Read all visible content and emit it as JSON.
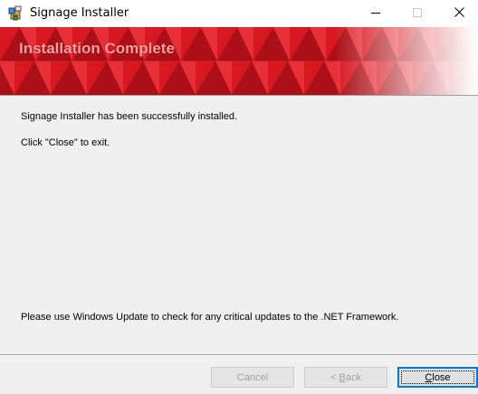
{
  "window": {
    "title": "Signage Installer",
    "icon": "installer-package-icon",
    "controls": {
      "minimize_icon": "minimize-icon",
      "maximize_icon": "maximize-icon",
      "close_icon": "close-icon"
    }
  },
  "banner": {
    "title": "Installation Complete",
    "colors": {
      "primary": "#d81820",
      "dark": "#8a0a12",
      "light": "#f04048"
    }
  },
  "content": {
    "success_message": "Signage Installer has been successfully installed.",
    "exit_instruction": "Click \"Close\" to exit.",
    "update_notice": "Please use Windows Update to check for any critical updates to the .NET Framework."
  },
  "buttons": {
    "cancel_label": "Cancel",
    "back_prefix": "< ",
    "back_mnemonic": "B",
    "back_rest": "ack",
    "close_mnemonic": "C",
    "close_rest": "lose"
  },
  "accent_color": "#0078d7"
}
